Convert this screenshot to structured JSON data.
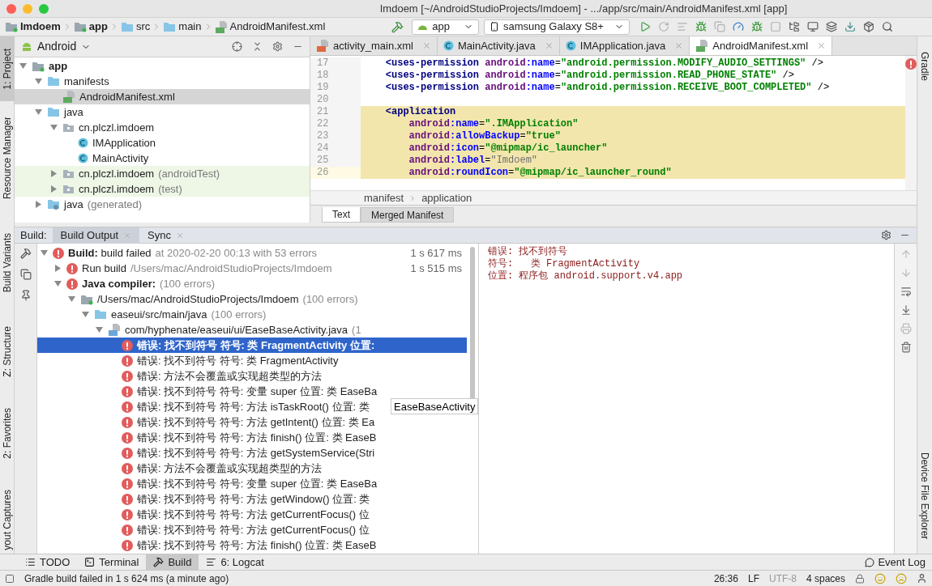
{
  "window": {
    "title": "Imdoem [~/AndroidStudioProjects/Imdoem] - .../app/src/main/AndroidManifest.xml [app]"
  },
  "navbar": {
    "breadcrumbs": [
      {
        "label": "Imdoem",
        "kind": "module",
        "bold": true
      },
      {
        "label": "app",
        "kind": "module",
        "bold": true
      },
      {
        "label": "src",
        "kind": "folder",
        "bold": false
      },
      {
        "label": "main",
        "kind": "folder",
        "bold": false
      },
      {
        "label": "AndroidManifest.xml",
        "kind": "manifest",
        "bold": false
      }
    ],
    "run_config": "app",
    "device": "samsung Galaxy S8+"
  },
  "left_stripe": [
    {
      "label": "1: Project",
      "selected": true
    },
    {
      "label": "Resource Manager",
      "selected": false
    },
    {
      "label": "Build Variants",
      "selected": false
    },
    {
      "label": "Z: Structure",
      "selected": false
    },
    {
      "label": "2: Favorites",
      "selected": false
    },
    {
      "label": "yout Captures",
      "selected": false
    }
  ],
  "right_stripe": [
    {
      "label": "Gradle"
    },
    {
      "label": "Device File Explorer"
    }
  ],
  "project": {
    "view": "Android",
    "tree": [
      {
        "label": "app",
        "kind": "module",
        "bold": true,
        "expanded": true,
        "selected": false,
        "highlighted": false,
        "children": [
          {
            "label": "manifests",
            "kind": "folder",
            "bold": false,
            "expanded": true,
            "selected": false,
            "highlighted": false,
            "children": [
              {
                "label": "AndroidManifest.xml",
                "kind": "manifest",
                "bold": false,
                "selected": true,
                "highlighted": false
              }
            ]
          },
          {
            "label": "java",
            "kind": "folder",
            "bold": false,
            "expanded": true,
            "selected": false,
            "highlighted": false,
            "children": [
              {
                "label": "cn.plczl.imdoem",
                "kind": "package",
                "bold": false,
                "expanded": true,
                "selected": false,
                "highlighted": false,
                "children": [
                  {
                    "label": "IMApplication",
                    "kind": "class",
                    "bold": false,
                    "selected": false,
                    "highlighted": false
                  },
                  {
                    "label": "MainActivity",
                    "kind": "class",
                    "bold": false,
                    "selected": false,
                    "highlighted": false
                  }
                ]
              },
              {
                "label": "cn.plczl.imdoem",
                "detail": "(androidTest)",
                "kind": "package",
                "bold": false,
                "expanded": false,
                "selected": false,
                "highlighted": true
              },
              {
                "label": "cn.plczl.imdoem",
                "detail": "(test)",
                "kind": "package",
                "bold": false,
                "expanded": false,
                "selected": false,
                "highlighted": true
              }
            ]
          },
          {
            "label": "java",
            "detail": "(generated)",
            "kind": "folder_gen",
            "bold": false,
            "expanded": false,
            "selected": false,
            "highlighted": false
          }
        ]
      }
    ]
  },
  "editor": {
    "tabs": [
      {
        "label": "activity_main.xml",
        "kind": "layout",
        "selected": false
      },
      {
        "label": "MainActivity.java",
        "kind": "class",
        "selected": false
      },
      {
        "label": "IMApplication.java",
        "kind": "class",
        "selected": false
      },
      {
        "label": "AndroidManifest.xml",
        "kind": "manifest",
        "selected": true
      }
    ],
    "lines": [
      {
        "number": "17",
        "highlighted": false,
        "current": false,
        "tokens": [
          {
            "text": "    <uses-permission ",
            "kind": "tag"
          },
          {
            "text": "android",
            "kind": "ns"
          },
          {
            "text": ":name",
            "kind": "attr"
          },
          {
            "text": "=",
            "kind": "plain"
          },
          {
            "text": "\"android.permission.MODIFY_AUDIO_SETTINGS\"",
            "kind": "value"
          },
          {
            "text": " />",
            "kind": "plain"
          }
        ]
      },
      {
        "number": "18",
        "highlighted": false,
        "current": false,
        "tokens": [
          {
            "text": "    <uses-permission ",
            "kind": "tag"
          },
          {
            "text": "android",
            "kind": "ns"
          },
          {
            "text": ":name",
            "kind": "attr"
          },
          {
            "text": "=",
            "kind": "plain"
          },
          {
            "text": "\"android.permission.READ_PHONE_STATE\"",
            "kind": "value"
          },
          {
            "text": " />",
            "kind": "plain"
          }
        ]
      },
      {
        "number": "19",
        "highlighted": false,
        "current": false,
        "tokens": [
          {
            "text": "    <uses-permission ",
            "kind": "tag"
          },
          {
            "text": "android",
            "kind": "ns"
          },
          {
            "text": ":name",
            "kind": "attr"
          },
          {
            "text": "=",
            "kind": "plain"
          },
          {
            "text": "\"android.permission.RECEIVE_BOOT_COMPLETED\"",
            "kind": "value"
          },
          {
            "text": " />",
            "kind": "plain"
          }
        ]
      },
      {
        "number": "20",
        "current": false
      },
      {
        "number": "21",
        "highlighted": true,
        "current": false,
        "tokens": [
          {
            "text": "    <application",
            "kind": "tag"
          }
        ]
      },
      {
        "number": "22",
        "highlighted": true,
        "current": false,
        "tokens": [
          {
            "text": "        android",
            "kind": "ns"
          },
          {
            "text": ":name",
            "kind": "attr"
          },
          {
            "text": "=",
            "kind": "plain"
          },
          {
            "text": "\".IMApplication\"",
            "kind": "value"
          }
        ]
      },
      {
        "number": "23",
        "highlighted": true,
        "current": false,
        "tokens": [
          {
            "text": "        android",
            "kind": "ns"
          },
          {
            "text": ":allowBackup",
            "kind": "attr"
          },
          {
            "text": "=",
            "kind": "plain"
          },
          {
            "text": "\"true\"",
            "kind": "value"
          }
        ]
      },
      {
        "number": "24",
        "highlighted": true,
        "current": false,
        "tokens": [
          {
            "text": "        android",
            "kind": "ns"
          },
          {
            "text": ":icon",
            "kind": "attr"
          },
          {
            "text": "=",
            "kind": "plain"
          },
          {
            "text": "\"@mipmap/ic_launcher\"",
            "kind": "value"
          }
        ]
      },
      {
        "number": "25",
        "highlighted": true,
        "current": false,
        "tokens": [
          {
            "text": "        android",
            "kind": "ns"
          },
          {
            "text": ":label",
            "kind": "attr"
          },
          {
            "text": "=",
            "kind": "plain"
          },
          {
            "text": "\"Imdoem\"",
            "kind": "dim"
          }
        ]
      },
      {
        "number": "26",
        "highlighted": true,
        "current": true,
        "tokens": [
          {
            "text": "        android",
            "kind": "ns"
          },
          {
            "text": ":roundIcon",
            "kind": "attr"
          },
          {
            "text": "=",
            "kind": "plain"
          },
          {
            "text": "\"@mipmap/ic_launcher_round\"",
            "kind": "value"
          }
        ]
      }
    ],
    "breadcrumb": [
      "manifest",
      "application"
    ],
    "bottom_tabs": [
      {
        "label": "Text",
        "selected": true
      },
      {
        "label": "Merged Manifest",
        "selected": false
      }
    ]
  },
  "build": {
    "title": "Build:",
    "tabs": [
      {
        "label": "Build Output",
        "selected": true
      },
      {
        "label": "Sync",
        "selected": false
      }
    ],
    "tree": [
      {
        "kind": "error",
        "label": "**Build:** build failed",
        "detail": "at 2020-02-20 00:13  with 53 errors",
        "time": "1 s 617 ms",
        "bold": false,
        "expanded": true,
        "selected": false,
        "children": [
          {
            "kind": "error",
            "label": "Run build",
            "detail": "/Users/mac/AndroidStudioProjects/Imdoem",
            "time": "1 s 515 ms",
            "bold": false,
            "expanded": false,
            "selected": false
          },
          {
            "kind": "error",
            "label": "Java compiler:",
            "detail": "(100 errors)",
            "bold": true,
            "expanded": true,
            "selected": false,
            "children": [
              {
                "kind": "module",
                "label": "/Users/mac/AndroidStudioProjects/Imdoem",
                "detail": "(100 errors)",
                "bold": false,
                "expanded": true,
                "selected": false,
                "children": [
                  {
                    "kind": "folder",
                    "label": "easeui/src/main/java",
                    "detail": "(100 errors)",
                    "bold": false,
                    "expanded": true,
                    "selected": false,
                    "children": [
                      {
                        "kind": "javafile",
                        "label": "com/hyphenate/easeui/ui/EaseBaseActivity.java",
                        "detail": "(1",
                        "bold": false,
                        "expanded": true,
                        "selected": false,
                        "children": [
                          {
                            "kind": "error",
                            "label": "错误: 找不到符号 符号:   类 FragmentActivity 位置:",
                            "bold": true,
                            "selected": true
                          },
                          {
                            "kind": "error",
                            "label": "错误: 找不到符号 符号: 类 FragmentActivity",
                            "bold": false,
                            "selected": false
                          },
                          {
                            "kind": "error",
                            "label": "错误: 方法不会覆盖或实现超类型的方法",
                            "bold": false,
                            "selected": false
                          },
                          {
                            "kind": "error",
                            "label": "错误: 找不到符号 符号:   变量 super 位置: 类 EaseBa",
                            "bold": false,
                            "selected": false
                          },
                          {
                            "kind": "error",
                            "label": "错误: 找不到符号 符号:   方法 isTaskRoot() 位置: 类",
                            "tooltip": "EaseBaseActivity",
                            "bold": false,
                            "selected": false
                          },
                          {
                            "kind": "error",
                            "label": "错误: 找不到符号 符号:   方法 getIntent() 位置: 类 Ea",
                            "bold": false,
                            "selected": false
                          },
                          {
                            "kind": "error",
                            "label": "错误: 找不到符号 符号:   方法 finish() 位置: 类 EaseB",
                            "bold": false,
                            "selected": false
                          },
                          {
                            "kind": "error",
                            "label": "错误: 找不到符号 符号:   方法 getSystemService(Stri",
                            "bold": false,
                            "selected": false
                          },
                          {
                            "kind": "error",
                            "label": "错误: 方法不会覆盖或实现超类型的方法",
                            "bold": false,
                            "selected": false
                          },
                          {
                            "kind": "error",
                            "label": "错误: 找不到符号 符号:   变量 super 位置: 类 EaseBa",
                            "bold": false,
                            "selected": false
                          },
                          {
                            "kind": "error",
                            "label": "错误: 找不到符号 符号:   方法 getWindow() 位置: 类",
                            "bold": false,
                            "selected": false
                          },
                          {
                            "kind": "error",
                            "label": "错误: 找不到符号 符号:   方法 getCurrentFocus() 位",
                            "bold": false,
                            "selected": false
                          },
                          {
                            "kind": "error",
                            "label": "错误: 找不到符号 符号:   方法 getCurrentFocus() 位",
                            "bold": false,
                            "selected": false
                          },
                          {
                            "kind": "error",
                            "label": "错误: 找不到符号 符号:   方法 finish() 位置: 类 EaseB",
                            "bold": false,
                            "selected": false
                          }
                        ]
                      }
                    ]
                  }
                ]
              }
            ]
          }
        ]
      }
    ],
    "output": [
      "错误: 找不到符号",
      "符号:   类 FragmentActivity",
      "位置: 程序包 android.support.v4.app"
    ]
  },
  "tool_windows": [
    {
      "label": "TODO",
      "kind": "list",
      "selected": false
    },
    {
      "label": "Terminal",
      "kind": "terminal",
      "selected": false
    },
    {
      "label": "Build",
      "kind": "hammer",
      "selected": true
    },
    {
      "label": "6: Logcat",
      "kind": "lines",
      "selected": false
    }
  ],
  "event_log": "Event Log",
  "status": {
    "message": "Gradle build failed in 1 s 624 ms (a minute ago)",
    "position": "26:36",
    "line_separator": "LF",
    "encoding": "UTF-8",
    "indent": "4 spaces"
  }
}
